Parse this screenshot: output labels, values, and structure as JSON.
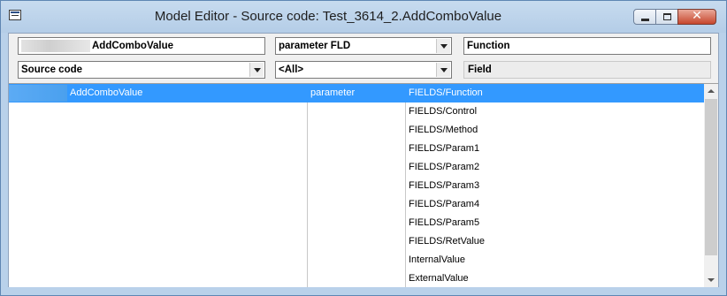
{
  "window": {
    "title": "Model Editor - Source code: Test_3614_2.AddComboValue",
    "controls": {
      "minimize": "minimize",
      "maximize": "maximize",
      "close": "✕"
    }
  },
  "toolbar": {
    "name_field": {
      "value": "AddComboValue"
    },
    "type_combo": {
      "value": "parameter FLD"
    },
    "kind_field": {
      "value": "Function"
    },
    "source_combo": {
      "value": "Source code"
    },
    "filter_combo": {
      "value": "<All>"
    },
    "field_label": "Field"
  },
  "list": {
    "selected_index": 0,
    "rows": [
      {
        "name": "AddComboValue",
        "type": "parameter",
        "field": "FIELDS/Function"
      },
      {
        "name": "",
        "type": "",
        "field": "FIELDS/Control"
      },
      {
        "name": "",
        "type": "",
        "field": "FIELDS/Method"
      },
      {
        "name": "",
        "type": "",
        "field": "FIELDS/Param1"
      },
      {
        "name": "",
        "type": "",
        "field": "FIELDS/Param2"
      },
      {
        "name": "",
        "type": "",
        "field": "FIELDS/Param3"
      },
      {
        "name": "",
        "type": "",
        "field": "FIELDS/Param4"
      },
      {
        "name": "",
        "type": "",
        "field": "FIELDS/Param5"
      },
      {
        "name": "",
        "type": "",
        "field": "FIELDS/RetValue"
      },
      {
        "name": "",
        "type": "",
        "field": "InternalValue"
      },
      {
        "name": "",
        "type": "",
        "field": "ExternalValue"
      }
    ]
  },
  "colors": {
    "selection": "#3399ff",
    "titlebar": "#b9d1ea",
    "close_button": "#c7472d"
  },
  "icons": [
    "app-window-icon",
    "minimize-icon",
    "maximize-icon",
    "close-icon",
    "chevron-down-icon",
    "scroll-up-icon",
    "scroll-down-icon"
  ]
}
